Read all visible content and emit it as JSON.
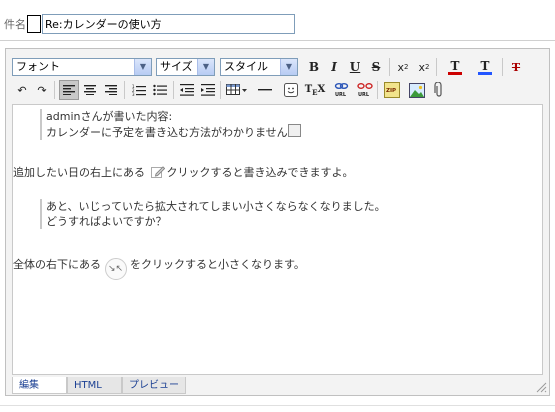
{
  "subject": {
    "label": "件名",
    "value": "Re:カレンダーの使い方"
  },
  "toolbar": {
    "font_select": "フォント",
    "size_select": "サイズ",
    "style_select": "スタイル",
    "bold": "B",
    "italic": "I",
    "underline": "U",
    "strike": "S",
    "subscript": "x",
    "superscript": "x",
    "text_color": "T",
    "bg_color": "T",
    "url_label": "URL",
    "zip_label": "ZIP"
  },
  "content": {
    "quote1_line1": "adminさんが書いた内容:",
    "quote1_line2": "カレンダーに予定を書き込む方法がわかりません",
    "para1_a": "追加したい日の右上にある",
    "para1_b": "クリックすると書き込みできますよ。",
    "quote2_line1": "あと、いじっていたら拡大されてしまい小さくならなくなりました。",
    "quote2_line2": "どうすればよいですか？",
    "para2_a": "全体の右下にある",
    "para2_b": "をクリックすると小さくなります。"
  },
  "tabs": {
    "edit": "編集",
    "html": "HTML",
    "preview": "プレビュー"
  },
  "colors": {
    "text_color_bar": "#cc0000",
    "bg_color_bar": "#2255ff"
  }
}
